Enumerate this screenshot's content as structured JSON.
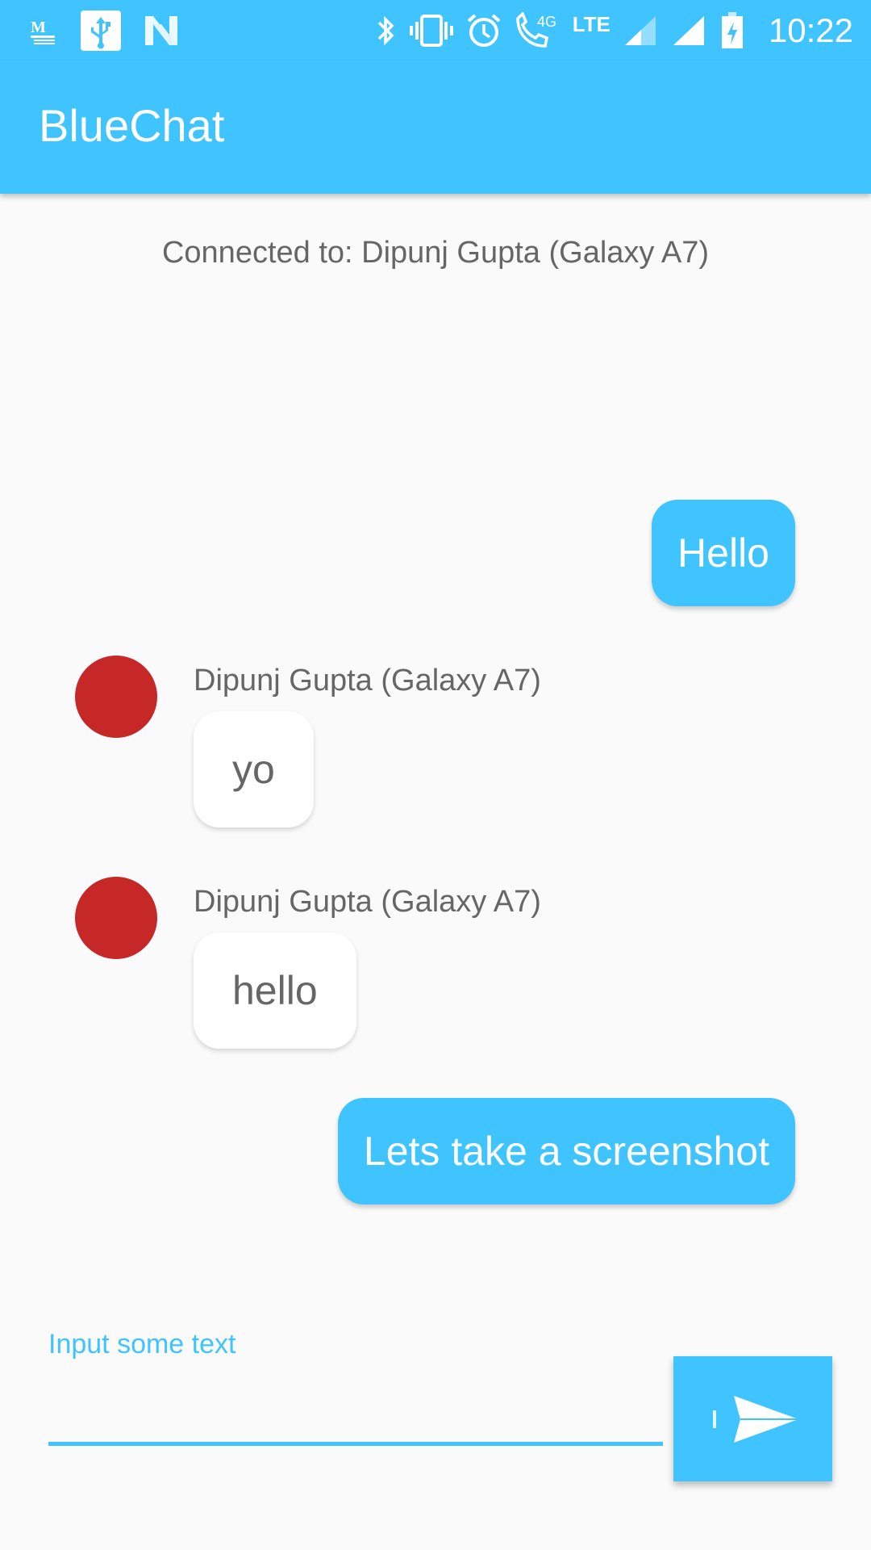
{
  "status_bar": {
    "time": "10:22",
    "network_label": "4G",
    "lte_label": "LTE",
    "left_icons": [
      "gmail-icon",
      "usb-icon",
      "n-icon"
    ],
    "right_icons": [
      "bluetooth-icon",
      "vibrate-icon",
      "alarm-icon",
      "call-4g-icon",
      "lte-icon",
      "signal-icon",
      "signal-icon",
      "battery-charging-icon"
    ]
  },
  "app_bar": {
    "title": "BlueChat"
  },
  "connection": {
    "text": "Connected to: Dipunj Gupta (Galaxy A7)"
  },
  "messages": [
    {
      "type": "sent",
      "text": "Hello"
    },
    {
      "type": "received",
      "sender": "Dipunj Gupta (Galaxy A7)",
      "text": "yo"
    },
    {
      "type": "received",
      "sender": "Dipunj Gupta (Galaxy A7)",
      "text": "hello"
    },
    {
      "type": "sent",
      "text": "Lets take a screenshot"
    }
  ],
  "composer": {
    "label": "Input some text",
    "value": "",
    "send_icon": "send-icon"
  },
  "colors": {
    "accent": "#40c4ff",
    "avatar": "#c62828",
    "background": "#fafafa",
    "muted_text": "#666666"
  }
}
